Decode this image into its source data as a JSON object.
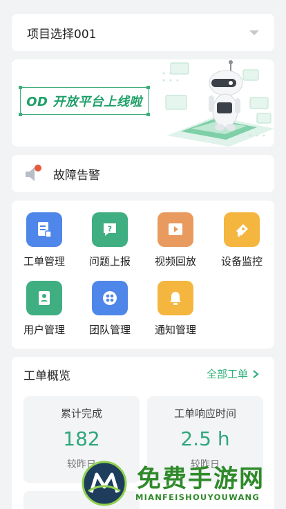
{
  "project": {
    "label": "项目选择001"
  },
  "banner": {
    "title": "OD 开放平台上线啦"
  },
  "alert": {
    "label": "故障告警"
  },
  "menu": {
    "items": [
      {
        "label": "工单管理",
        "color": "#4f86e9",
        "icon": "document-icon"
      },
      {
        "label": "问题上报",
        "color": "#3fae80",
        "icon": "question-icon"
      },
      {
        "label": "视频回放",
        "color": "#e99a5e",
        "icon": "play-icon"
      },
      {
        "label": "设备监控",
        "color": "#f4b63f",
        "icon": "camera-icon"
      },
      {
        "label": "用户管理",
        "color": "#3fae80",
        "icon": "user-book-icon"
      },
      {
        "label": "团队管理",
        "color": "#4f86e9",
        "icon": "team-icon"
      },
      {
        "label": "通知管理",
        "color": "#f4b63f",
        "icon": "bell-icon"
      }
    ]
  },
  "overview": {
    "title": "工单概览",
    "all_link": "全部工单",
    "stats": [
      {
        "label": "累计完成",
        "value": "182",
        "compare": "较昨日"
      },
      {
        "label": "工单响应时间",
        "value": "2.5 h",
        "compare": "较昨日"
      }
    ]
  },
  "watermark": {
    "cn": "免费手游网",
    "en": "MIANFEISHOUYOUWANG"
  },
  "colors": {
    "accent": "#2fb07a",
    "background": "#f2f3f5"
  }
}
